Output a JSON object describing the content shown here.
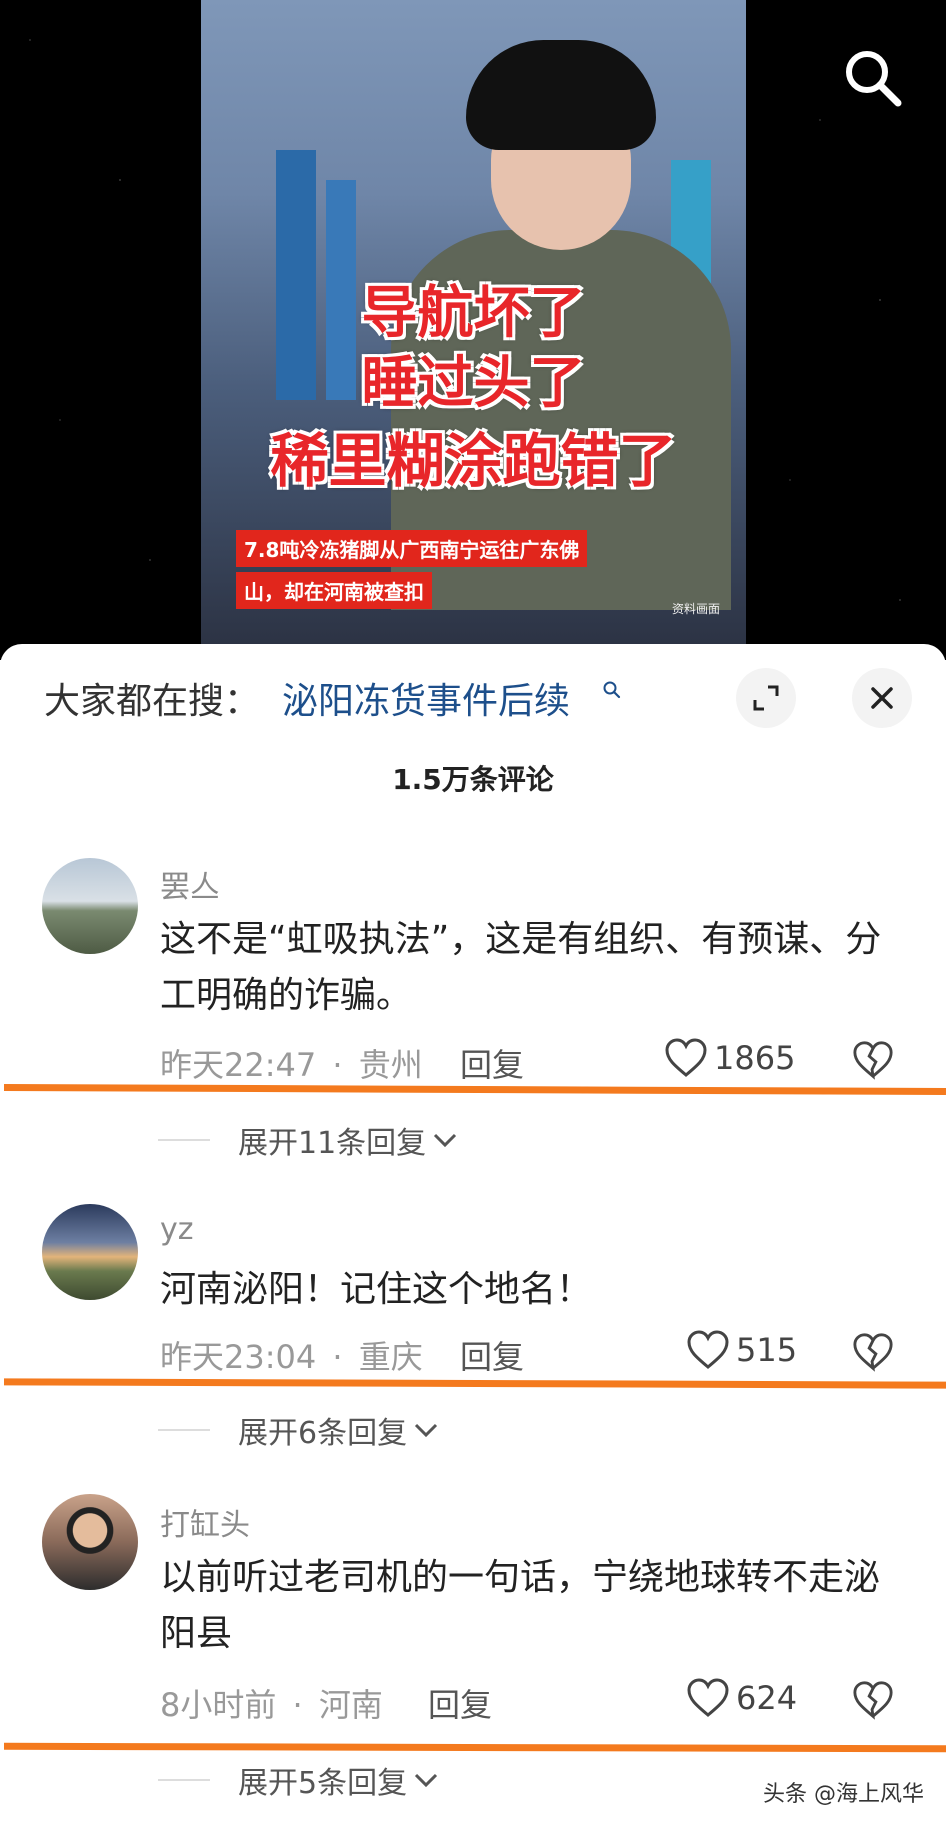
{
  "video": {
    "caption_lines": [
      "导航坏了",
      "睡过头了",
      "稀里糊涂跑错了"
    ],
    "subtitle_lines": [
      "7.8吨冷冻猪脚从广西南宁运往广东佛",
      "山，却在河南被查扣"
    ],
    "source_note": "资料画面"
  },
  "trending": {
    "prefix": "大家都在搜：",
    "query": "泌阳冻货事件后续"
  },
  "comments_count": "1.5万条评论",
  "comments": [
    {
      "name": "罢亼",
      "text": "这不是“虹吸执法”，这是有组织、有预谋、分工明确的诈骗。",
      "time": "昨天22:47",
      "location": "贵州",
      "reply": "回复",
      "likes": "1865",
      "expand": "展开11条回复"
    },
    {
      "name": "yz",
      "text": "河南泌阳！记住这个地名！",
      "time": "昨天23:04",
      "location": "重庆",
      "reply": "回复",
      "likes": "515",
      "expand": "展开6条回复"
    },
    {
      "name": "打缸头",
      "text": "以前听过老司机的一句话，宁绕地球转不走泌阳县",
      "time": "8小时前",
      "location": "河南",
      "reply": "回复",
      "likes": "624",
      "expand": "展开5条回复"
    }
  ],
  "separator": "·",
  "watermark": "头条 @海上风华",
  "colors": {
    "accent_orange": "#f47a1e",
    "link_blue": "#1d4f8b",
    "caption_red": "#e8262a"
  },
  "icons": [
    "search-icon",
    "expand-icon",
    "close-icon",
    "heart-icon",
    "broken-heart-icon",
    "chevron-down-icon"
  ]
}
